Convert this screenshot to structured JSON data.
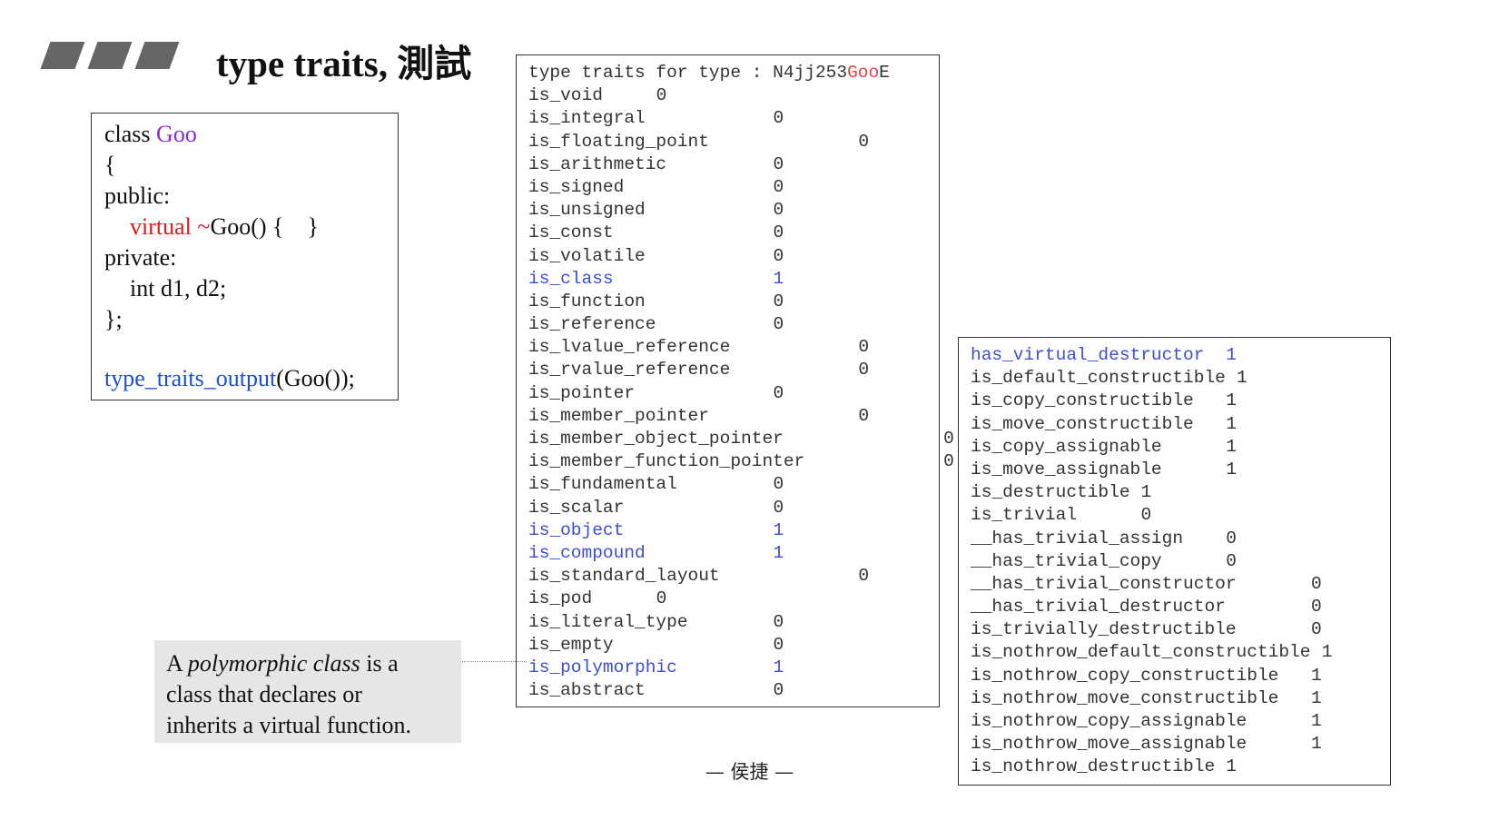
{
  "title": "type traits, 測試",
  "code": {
    "l1_prefix": "class ",
    "l1_name": "Goo",
    "l2": "{",
    "l3": "public:",
    "l4_keyword": "virtual",
    "l4_tilde": " ~",
    "l4_rest": "Goo() {    }",
    "l5": "private:",
    "l6": "int d1, d2;",
    "l7": "};",
    "call_func": "type_traits_output",
    "call_args": "(Goo());"
  },
  "note": {
    "line1_pre": "A ",
    "line1_em": "polymorphic class",
    "line1_post": " is a",
    "line2": "class that declares or",
    "line3": "inherits a virtual function."
  },
  "traits_header": {
    "prefix": "type traits for type : N4jj253",
    "name": "Goo",
    "suffix": "E"
  },
  "traits_left": [
    {
      "name": "is_void",
      "value": "0",
      "col": 12,
      "hl": false
    },
    {
      "name": "is_integral",
      "value": "0",
      "col": 23,
      "hl": false
    },
    {
      "name": "is_floating_point",
      "value": "0",
      "col": 31,
      "hl": false
    },
    {
      "name": "is_arithmetic",
      "value": "0",
      "col": 23,
      "hl": false
    },
    {
      "name": "is_signed",
      "value": "0",
      "col": 23,
      "hl": false
    },
    {
      "name": "is_unsigned",
      "value": "0",
      "col": 23,
      "hl": false
    },
    {
      "name": "is_const",
      "value": "0",
      "col": 23,
      "hl": false
    },
    {
      "name": "is_volatile",
      "value": "0",
      "col": 23,
      "hl": false
    },
    {
      "name": "is_class",
      "value": "1",
      "col": 23,
      "hl": true
    },
    {
      "name": "is_function",
      "value": "0",
      "col": 23,
      "hl": false
    },
    {
      "name": "is_reference",
      "value": "0",
      "col": 23,
      "hl": false
    },
    {
      "name": "is_lvalue_reference",
      "value": "0",
      "col": 31,
      "hl": false
    },
    {
      "name": "is_rvalue_reference",
      "value": "0",
      "col": 31,
      "hl": false
    },
    {
      "name": "is_pointer",
      "value": "0",
      "col": 23,
      "hl": false
    },
    {
      "name": "is_member_pointer",
      "value": "0",
      "col": 31,
      "hl": false
    },
    {
      "name": "is_member_object_pointer",
      "value": "0",
      "col": 39,
      "hl": false
    },
    {
      "name": "is_member_function_pointer",
      "value": "0",
      "col": 39,
      "hl": false
    },
    {
      "name": "is_fundamental",
      "value": "0",
      "col": 23,
      "hl": false
    },
    {
      "name": "is_scalar",
      "value": "0",
      "col": 23,
      "hl": false
    },
    {
      "name": "is_object",
      "value": "1",
      "col": 23,
      "hl": true
    },
    {
      "name": "is_compound",
      "value": "1",
      "col": 23,
      "hl": true
    },
    {
      "name": "is_standard_layout",
      "value": "0",
      "col": 31,
      "hl": false
    },
    {
      "name": "is_pod",
      "value": "0",
      "col": 12,
      "hl": false
    },
    {
      "name": "is_literal_type",
      "value": "0",
      "col": 23,
      "hl": false
    },
    {
      "name": "is_empty",
      "value": "0",
      "col": 23,
      "hl": false
    },
    {
      "name": "is_polymorphic",
      "value": "1",
      "col": 23,
      "hl": true
    },
    {
      "name": "is_abstract",
      "value": "0",
      "col": 23,
      "hl": false
    }
  ],
  "traits_right": [
    {
      "name": "has_virtual_destructor",
      "value": "1",
      "col": 24,
      "hl": true
    },
    {
      "name": "is_default_constructible",
      "value": "1",
      "col": 25,
      "hl": false
    },
    {
      "name": "is_copy_constructible",
      "value": "1",
      "col": 24,
      "hl": false
    },
    {
      "name": "is_move_constructible",
      "value": "1",
      "col": 24,
      "hl": false
    },
    {
      "name": "is_copy_assignable",
      "value": "1",
      "col": 24,
      "hl": false
    },
    {
      "name": "is_move_assignable",
      "value": "1",
      "col": 24,
      "hl": false
    },
    {
      "name": "is_destructible",
      "value": "1",
      "col": 16,
      "hl": false
    },
    {
      "name": "is_trivial",
      "value": "0",
      "col": 16,
      "hl": false
    },
    {
      "name": "__has_trivial_assign",
      "value": "0",
      "col": 24,
      "hl": false
    },
    {
      "name": "__has_trivial_copy",
      "value": "0",
      "col": 24,
      "hl": false
    },
    {
      "name": "__has_trivial_constructor",
      "value": "0",
      "col": 32,
      "hl": false
    },
    {
      "name": "__has_trivial_destructor",
      "value": "0",
      "col": 32,
      "hl": false
    },
    {
      "name": "is_trivially_destructible",
      "value": "0",
      "col": 32,
      "hl": false
    },
    {
      "name": "is_nothrow_default_constructible",
      "value": "1",
      "col": 33,
      "hl": false
    },
    {
      "name": "is_nothrow_copy_constructible",
      "value": "1",
      "col": 32,
      "hl": false
    },
    {
      "name": "is_nothrow_move_constructible",
      "value": "1",
      "col": 32,
      "hl": false
    },
    {
      "name": "is_nothrow_copy_assignable",
      "value": "1",
      "col": 32,
      "hl": false
    },
    {
      "name": "is_nothrow_move_assignable",
      "value": "1",
      "col": 32,
      "hl": false
    },
    {
      "name": "is_nothrow_destructible",
      "value": "1",
      "col": 24,
      "hl": false
    }
  ],
  "footer": "— 侯捷 —",
  "colors": {
    "title_bars": "#666666",
    "class_name": "#8a2be2",
    "keyword": "#e8141b",
    "function_call": "#1a4fd6",
    "highlighted_trait": "#3d4ed0",
    "note_background": "#e6e6e6"
  }
}
